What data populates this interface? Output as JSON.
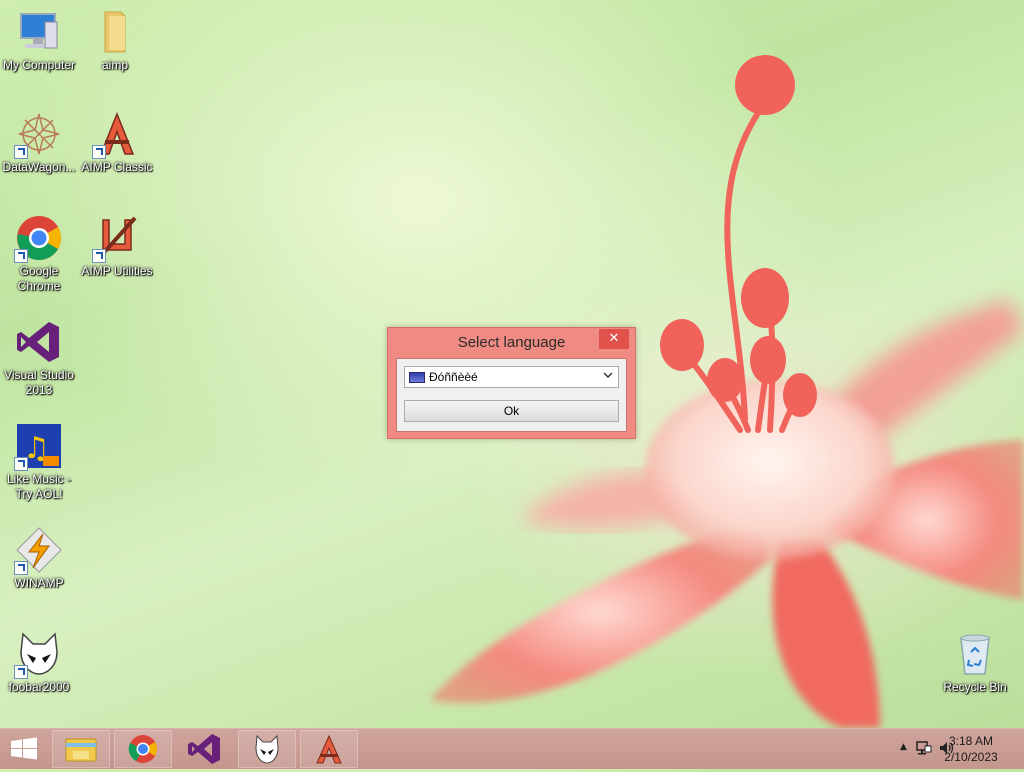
{
  "desktop": {
    "icons": [
      {
        "label": "My Computer"
      },
      {
        "label": "aimp"
      },
      {
        "label": "DataWagon..."
      },
      {
        "label": "AIMP Classic"
      },
      {
        "label": "Google Chrome"
      },
      {
        "label": "AIMP Utilities"
      },
      {
        "label": "Visual Studio 2013"
      },
      {
        "label": "Like Music - Try AOL!"
      },
      {
        "label": "WINAMP"
      },
      {
        "label": "foobar2000"
      },
      {
        "label": "Recycle Bin"
      }
    ]
  },
  "dialog": {
    "title": "Select language",
    "close_symbol": "✕",
    "select_value": "Đóññèèé",
    "ok_label": "Ok"
  },
  "taskbar": {
    "time": "3:18 AM",
    "date": "2/10/2023",
    "tray_chevron": "▲"
  },
  "colors": {
    "dialog_frame": "#ef8b82",
    "close_button": "#e0524a",
    "taskbar": "#c4968d"
  }
}
